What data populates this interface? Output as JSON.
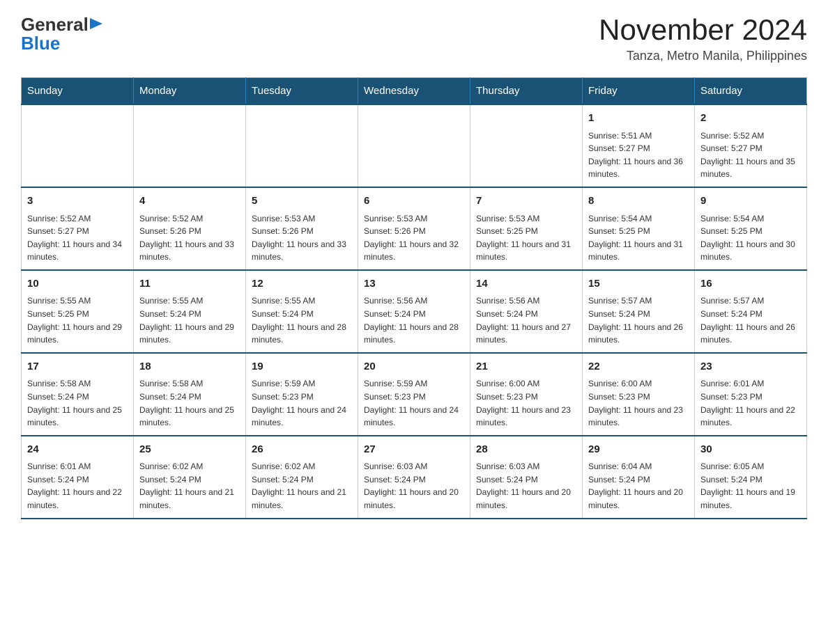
{
  "header": {
    "logo_general": "General",
    "logo_blue": "Blue",
    "month_title": "November 2024",
    "location": "Tanza, Metro Manila, Philippines"
  },
  "days_of_week": [
    "Sunday",
    "Monday",
    "Tuesday",
    "Wednesday",
    "Thursday",
    "Friday",
    "Saturday"
  ],
  "weeks": [
    {
      "days": [
        {
          "number": "",
          "info": ""
        },
        {
          "number": "",
          "info": ""
        },
        {
          "number": "",
          "info": ""
        },
        {
          "number": "",
          "info": ""
        },
        {
          "number": "",
          "info": ""
        },
        {
          "number": "1",
          "info": "Sunrise: 5:51 AM\nSunset: 5:27 PM\nDaylight: 11 hours and 36 minutes."
        },
        {
          "number": "2",
          "info": "Sunrise: 5:52 AM\nSunset: 5:27 PM\nDaylight: 11 hours and 35 minutes."
        }
      ]
    },
    {
      "days": [
        {
          "number": "3",
          "info": "Sunrise: 5:52 AM\nSunset: 5:27 PM\nDaylight: 11 hours and 34 minutes."
        },
        {
          "number": "4",
          "info": "Sunrise: 5:52 AM\nSunset: 5:26 PM\nDaylight: 11 hours and 33 minutes."
        },
        {
          "number": "5",
          "info": "Sunrise: 5:53 AM\nSunset: 5:26 PM\nDaylight: 11 hours and 33 minutes."
        },
        {
          "number": "6",
          "info": "Sunrise: 5:53 AM\nSunset: 5:26 PM\nDaylight: 11 hours and 32 minutes."
        },
        {
          "number": "7",
          "info": "Sunrise: 5:53 AM\nSunset: 5:25 PM\nDaylight: 11 hours and 31 minutes."
        },
        {
          "number": "8",
          "info": "Sunrise: 5:54 AM\nSunset: 5:25 PM\nDaylight: 11 hours and 31 minutes."
        },
        {
          "number": "9",
          "info": "Sunrise: 5:54 AM\nSunset: 5:25 PM\nDaylight: 11 hours and 30 minutes."
        }
      ]
    },
    {
      "days": [
        {
          "number": "10",
          "info": "Sunrise: 5:55 AM\nSunset: 5:25 PM\nDaylight: 11 hours and 29 minutes."
        },
        {
          "number": "11",
          "info": "Sunrise: 5:55 AM\nSunset: 5:24 PM\nDaylight: 11 hours and 29 minutes."
        },
        {
          "number": "12",
          "info": "Sunrise: 5:55 AM\nSunset: 5:24 PM\nDaylight: 11 hours and 28 minutes."
        },
        {
          "number": "13",
          "info": "Sunrise: 5:56 AM\nSunset: 5:24 PM\nDaylight: 11 hours and 28 minutes."
        },
        {
          "number": "14",
          "info": "Sunrise: 5:56 AM\nSunset: 5:24 PM\nDaylight: 11 hours and 27 minutes."
        },
        {
          "number": "15",
          "info": "Sunrise: 5:57 AM\nSunset: 5:24 PM\nDaylight: 11 hours and 26 minutes."
        },
        {
          "number": "16",
          "info": "Sunrise: 5:57 AM\nSunset: 5:24 PM\nDaylight: 11 hours and 26 minutes."
        }
      ]
    },
    {
      "days": [
        {
          "number": "17",
          "info": "Sunrise: 5:58 AM\nSunset: 5:24 PM\nDaylight: 11 hours and 25 minutes."
        },
        {
          "number": "18",
          "info": "Sunrise: 5:58 AM\nSunset: 5:24 PM\nDaylight: 11 hours and 25 minutes."
        },
        {
          "number": "19",
          "info": "Sunrise: 5:59 AM\nSunset: 5:23 PM\nDaylight: 11 hours and 24 minutes."
        },
        {
          "number": "20",
          "info": "Sunrise: 5:59 AM\nSunset: 5:23 PM\nDaylight: 11 hours and 24 minutes."
        },
        {
          "number": "21",
          "info": "Sunrise: 6:00 AM\nSunset: 5:23 PM\nDaylight: 11 hours and 23 minutes."
        },
        {
          "number": "22",
          "info": "Sunrise: 6:00 AM\nSunset: 5:23 PM\nDaylight: 11 hours and 23 minutes."
        },
        {
          "number": "23",
          "info": "Sunrise: 6:01 AM\nSunset: 5:23 PM\nDaylight: 11 hours and 22 minutes."
        }
      ]
    },
    {
      "days": [
        {
          "number": "24",
          "info": "Sunrise: 6:01 AM\nSunset: 5:24 PM\nDaylight: 11 hours and 22 minutes."
        },
        {
          "number": "25",
          "info": "Sunrise: 6:02 AM\nSunset: 5:24 PM\nDaylight: 11 hours and 21 minutes."
        },
        {
          "number": "26",
          "info": "Sunrise: 6:02 AM\nSunset: 5:24 PM\nDaylight: 11 hours and 21 minutes."
        },
        {
          "number": "27",
          "info": "Sunrise: 6:03 AM\nSunset: 5:24 PM\nDaylight: 11 hours and 20 minutes."
        },
        {
          "number": "28",
          "info": "Sunrise: 6:03 AM\nSunset: 5:24 PM\nDaylight: 11 hours and 20 minutes."
        },
        {
          "number": "29",
          "info": "Sunrise: 6:04 AM\nSunset: 5:24 PM\nDaylight: 11 hours and 20 minutes."
        },
        {
          "number": "30",
          "info": "Sunrise: 6:05 AM\nSunset: 5:24 PM\nDaylight: 11 hours and 19 minutes."
        }
      ]
    }
  ]
}
